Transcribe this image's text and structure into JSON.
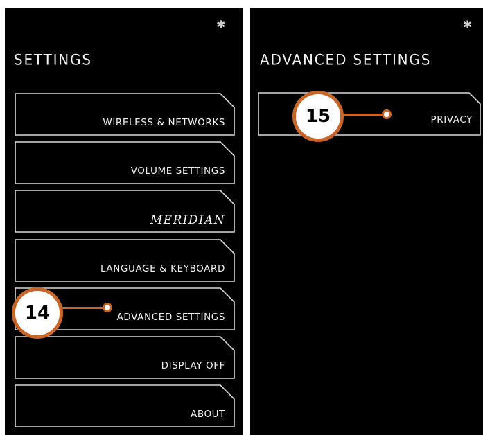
{
  "left_screen": {
    "title": "SETTINGS",
    "items": [
      {
        "label": "WIRELESS & NETWORKS"
      },
      {
        "label": "VOLUME SETTINGS"
      },
      {
        "label": "MERIDIAN"
      },
      {
        "label": "LANGUAGE & KEYBOARD"
      },
      {
        "label": "ADVANCED SETTINGS"
      },
      {
        "label": "DISPLAY OFF"
      },
      {
        "label": "ABOUT"
      }
    ]
  },
  "right_screen": {
    "title": "ADVANCED SETTINGS",
    "items": [
      {
        "label": "PRIVACY"
      }
    ]
  },
  "callouts": [
    {
      "number": "14"
    },
    {
      "number": "15"
    }
  ],
  "icons": {
    "status": "bluetooth-icon",
    "glyph": "✱"
  },
  "colors": {
    "screen_bg": "#000000",
    "button_outline": "#d9d9d9",
    "text": "#f2f2f2",
    "callout_accent": "#c8662a"
  }
}
